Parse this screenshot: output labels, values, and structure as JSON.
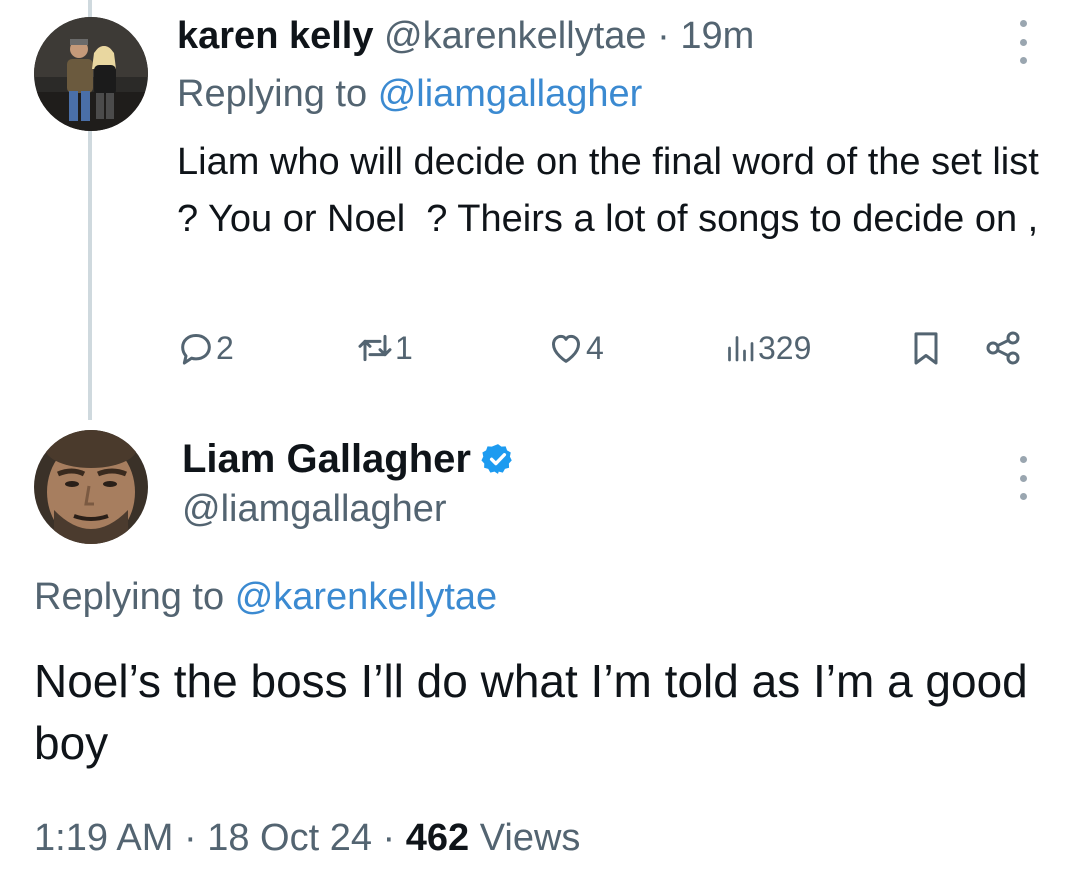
{
  "reply_tweet": {
    "author_name": "karen kelly",
    "handle": "@karenkellytae",
    "separator": "·",
    "time_ago": "19m",
    "replying_prefix": "Replying to",
    "replying_to": "@liamgallagher",
    "text": "Liam who will decide on the final word of the set list ? You or Noel  ? Theirs a lot of songs to decide on ,",
    "actions": {
      "replies": "2",
      "reposts": "1",
      "likes": "4",
      "views": "329"
    }
  },
  "main_tweet": {
    "author_name": "Liam Gallagher",
    "verified": true,
    "handle": "@liamgallagher",
    "replying_prefix": "Replying to",
    "replying_to": "@karenkellytae",
    "text": "Noel’s the boss I’ll do what I’m told as I’m a good boy",
    "time": "1:19 AM",
    "date": "18 Oct 24",
    "separator": "·",
    "views_count": "462",
    "views_label": "Views"
  },
  "colors": {
    "text_primary": "#0f1419",
    "text_secondary": "#536471",
    "link": "#3b8ad1",
    "verified_badge": "#1d9bf0",
    "thread_line": "#cfd9de"
  },
  "icons": [
    "more-icon",
    "reply-icon",
    "repost-icon",
    "like-icon",
    "views-icon",
    "bookmark-icon",
    "share-icon",
    "verified-badge-icon"
  ]
}
